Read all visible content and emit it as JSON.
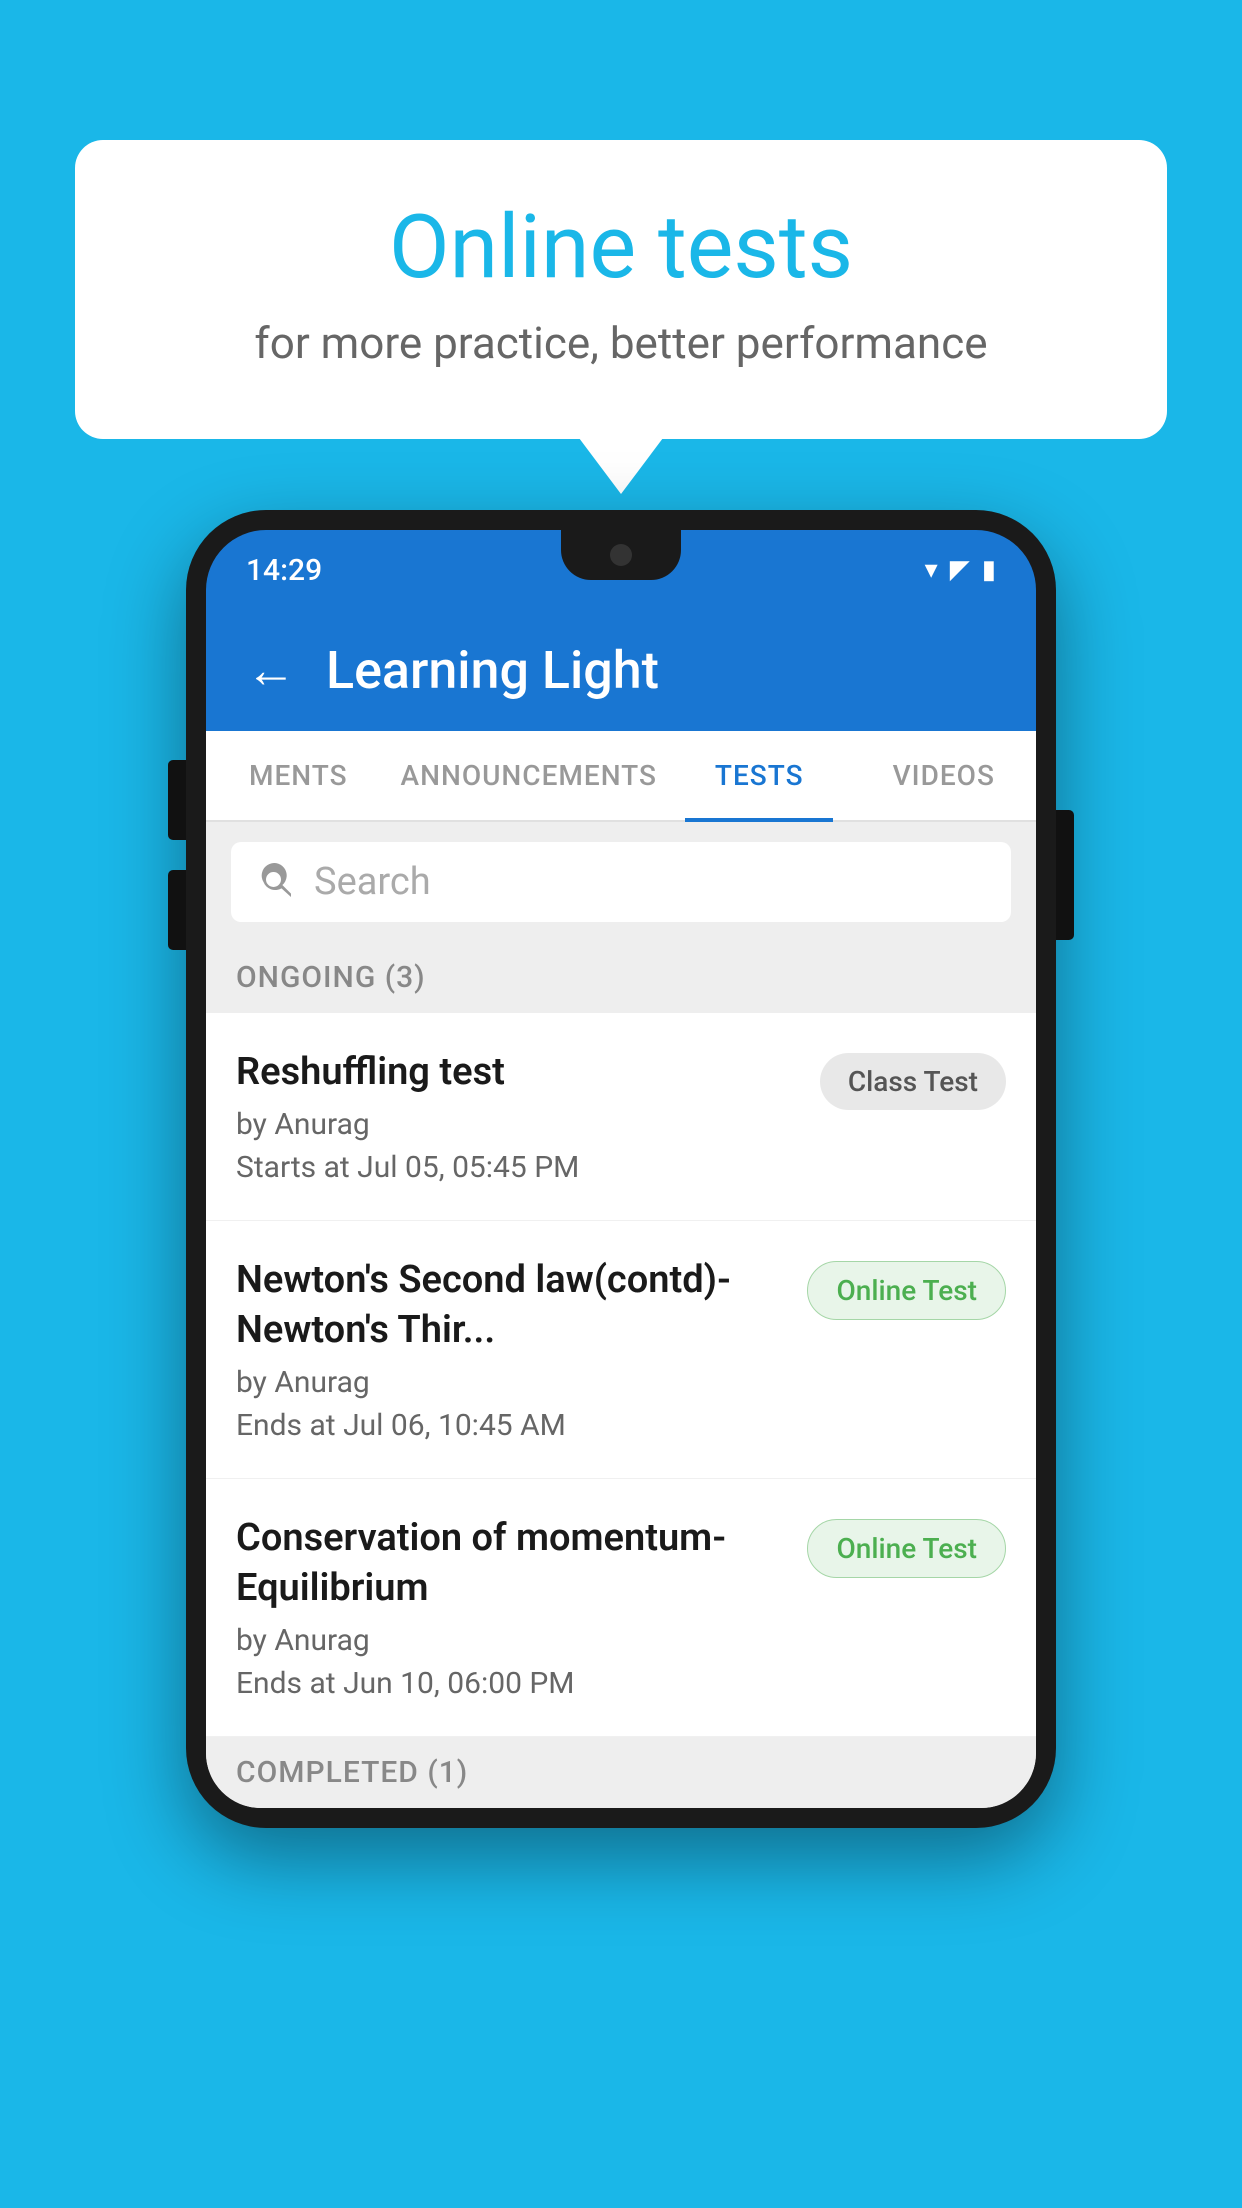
{
  "background_color": "#1ab7e8",
  "bubble": {
    "title": "Online tests",
    "subtitle": "for more practice, better performance"
  },
  "phone": {
    "status_bar": {
      "time": "14:29",
      "wifi": "▾",
      "signal": "▲",
      "battery": "▮"
    },
    "header": {
      "title": "Learning Light",
      "back_label": "←"
    },
    "tabs": [
      {
        "label": "MENTS",
        "active": false
      },
      {
        "label": "ANNOUNCEMENTS",
        "active": false
      },
      {
        "label": "TESTS",
        "active": true
      },
      {
        "label": "VIDEOS",
        "active": false
      }
    ],
    "search": {
      "placeholder": "Search"
    },
    "ongoing_section": {
      "label": "ONGOING (3)"
    },
    "tests": [
      {
        "name": "Reshuffling test",
        "by": "by Anurag",
        "time_label": "Starts at",
        "time": "Jul 05, 05:45 PM",
        "badge": "Class Test",
        "badge_type": "class"
      },
      {
        "name": "Newton's Second law(contd)-Newton's Thir...",
        "by": "by Anurag",
        "time_label": "Ends at",
        "time": "Jul 06, 10:45 AM",
        "badge": "Online Test",
        "badge_type": "online"
      },
      {
        "name": "Conservation of momentum-Equilibrium",
        "by": "by Anurag",
        "time_label": "Ends at",
        "time": "Jun 10, 06:00 PM",
        "badge": "Online Test",
        "badge_type": "online"
      }
    ],
    "completed_section": {
      "label": "COMPLETED (1)"
    }
  }
}
